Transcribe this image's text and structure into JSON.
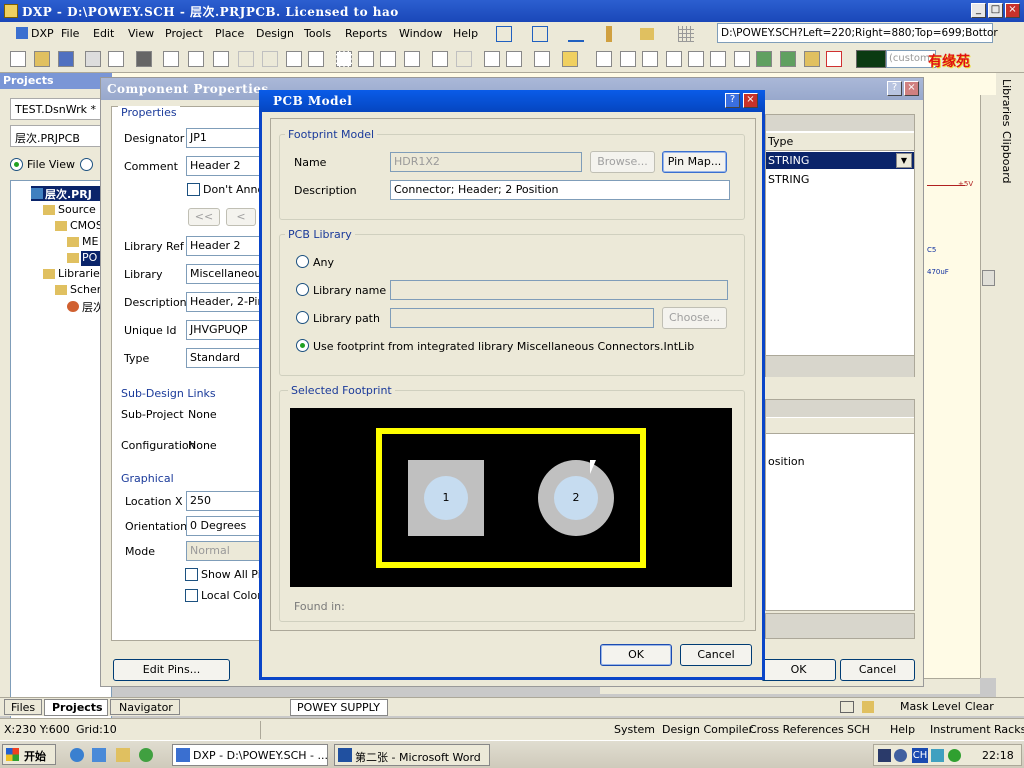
{
  "app": {
    "title": "DXP - D:\\POWEY.SCH - 层次.PRJPCB. Licensed to hao",
    "window_controls": [
      "_",
      "□",
      "×"
    ]
  },
  "menu": {
    "items": [
      "DXP",
      "File",
      "Edit",
      "View",
      "Project",
      "Place",
      "Design",
      "Tools",
      "Reports",
      "Window",
      "Help"
    ],
    "path_combo": "D:\\POWEY.SCH?Left=220;Right=880;Top=699;Bottor",
    "custom_combo": "(custom",
    "logo_text": "有缘苑"
  },
  "projects_panel": {
    "title": "Projects",
    "workspace": "TEST.DsnWrk *",
    "project": "层次.PRJPCB",
    "file_view": "File View",
    "tree": [
      "层次.PRJ",
      "Source D",
      "CMOS",
      "ME",
      "PO",
      "Libraries",
      "Scher",
      "层次"
    ]
  },
  "component_properties": {
    "title": "Component Properties",
    "properties_label": "Properties",
    "designator_label": "Designator",
    "designator_value": "JP1",
    "comment_label": "Comment",
    "comment_value": "Header 2",
    "dont_annotate": "Don't Annot",
    "nav_prev_prev": "<<",
    "nav_prev": "<",
    "library_ref_label": "Library Ref",
    "library_ref_value": "Header 2",
    "library_label": "Library",
    "library_value": "Miscellaneous",
    "description_label": "Description",
    "description_value": "Header, 2-Pin",
    "unique_id_label": "Unique Id",
    "unique_id_value": "JHVGPUQP",
    "type_label": "Type",
    "type_value": "Standard",
    "subdesign_label": "Sub-Design Links",
    "subproject_label": "Sub-Project",
    "subproject_value": "None",
    "configuration_label": "Configuration",
    "configuration_value": "None",
    "graphical_label": "Graphical",
    "location_label": "Location X",
    "location_value": "250",
    "orientation_label": "Orientation",
    "orientation_value": "0 Degrees",
    "mode_label": "Mode",
    "mode_value": "Normal",
    "show_all_pins": "Show All Pir",
    "local_colors": "Local Colors",
    "edit_pins": "Edit Pins...",
    "ok": "OK",
    "cancel": "Cancel",
    "type_header": "Type",
    "type_row1": "STRING",
    "type_row2": "STRING",
    "position_text": "osition",
    "schematic_text1": "+5V",
    "schematic_text2": "C5",
    "schematic_text3": "470uF"
  },
  "pcb_model": {
    "title": "PCB Model",
    "help_btn": "?",
    "close_btn": "×",
    "footprint_model_label": "Footprint Model",
    "name_label": "Name",
    "name_value": "HDR1X2",
    "browse": "Browse...",
    "pin_map": "Pin Map...",
    "description_label": "Description",
    "description_value": "Connector; Header; 2 Position",
    "pcb_library_label": "PCB Library",
    "any": "Any",
    "library_name": "Library name",
    "library_path": "Library path",
    "choose": "Choose...",
    "use_integrated": "Use footprint from integrated library Miscellaneous Connectors.IntLib",
    "selected_footprint_label": "Selected Footprint",
    "pad1": "1",
    "pad2": "2",
    "found_in": "Found in:",
    "ok": "OK",
    "cancel": "Cancel"
  },
  "right_panels": [
    "Libraries",
    "Clipboard"
  ],
  "bottom_tabs": {
    "files": "Files",
    "projects": "Projects",
    "navigator": "Navigator",
    "sheet": "POWEY SUPPLY",
    "mask_level": "Mask Level",
    "clear": "Clear"
  },
  "status": {
    "coords": "X:230 Y:600",
    "grid": "Grid:10",
    "system": "System",
    "design_compiler": "Design Compiler",
    "cross_references": "Cross References",
    "sch": "SCH",
    "help": "Help",
    "instrument_racks": "Instrument Racks"
  },
  "taskbar": {
    "start": "开始",
    "task1": "DXP - D:\\POWEY.SCH - ...",
    "task2": "第二张 - Microsoft Word",
    "tray_ch": "CH",
    "clock": "22:18"
  }
}
